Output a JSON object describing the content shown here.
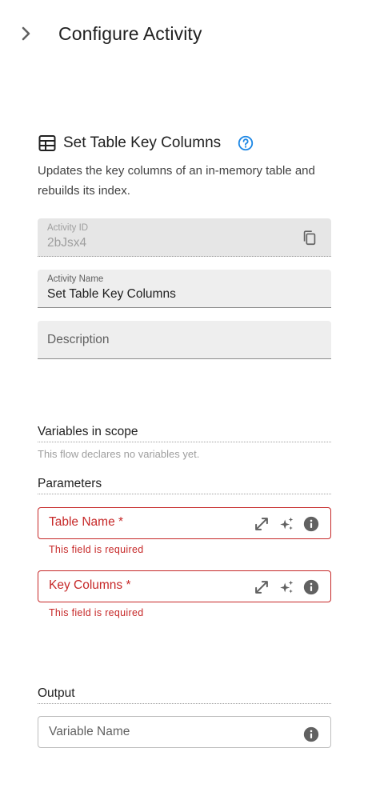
{
  "header": {
    "title": "Configure Activity",
    "collapse_icon": "chevron-right-icon"
  },
  "activity": {
    "icon": "table-icon",
    "title": "Set Table Key Columns",
    "help_icon": "help-circle-icon",
    "description": "Updates the key columns of an in-memory table and rebuilds its index."
  },
  "fields": {
    "activity_id": {
      "label": "Activity ID",
      "value": "2bJsx4",
      "icon": "copy-icon"
    },
    "activity_name": {
      "label": "Activity Name",
      "value": "Set Table Key Columns"
    },
    "description": {
      "placeholder": "Description"
    }
  },
  "variables": {
    "heading": "Variables in scope",
    "hint": "This flow declares no variables yet."
  },
  "parameters": {
    "heading": "Parameters",
    "items": [
      {
        "label": "Table Name *",
        "error": "This field is required"
      },
      {
        "label": "Key Columns *",
        "error": "This field is required"
      }
    ],
    "icons": [
      "expand-icon",
      "sparkles-icon",
      "info-icon"
    ]
  },
  "output": {
    "heading": "Output",
    "placeholder": "Variable Name",
    "icon": "info-icon"
  },
  "colors": {
    "error": "#c62828",
    "accent": "#1e88e5",
    "field_bg": "#eeeeee"
  }
}
